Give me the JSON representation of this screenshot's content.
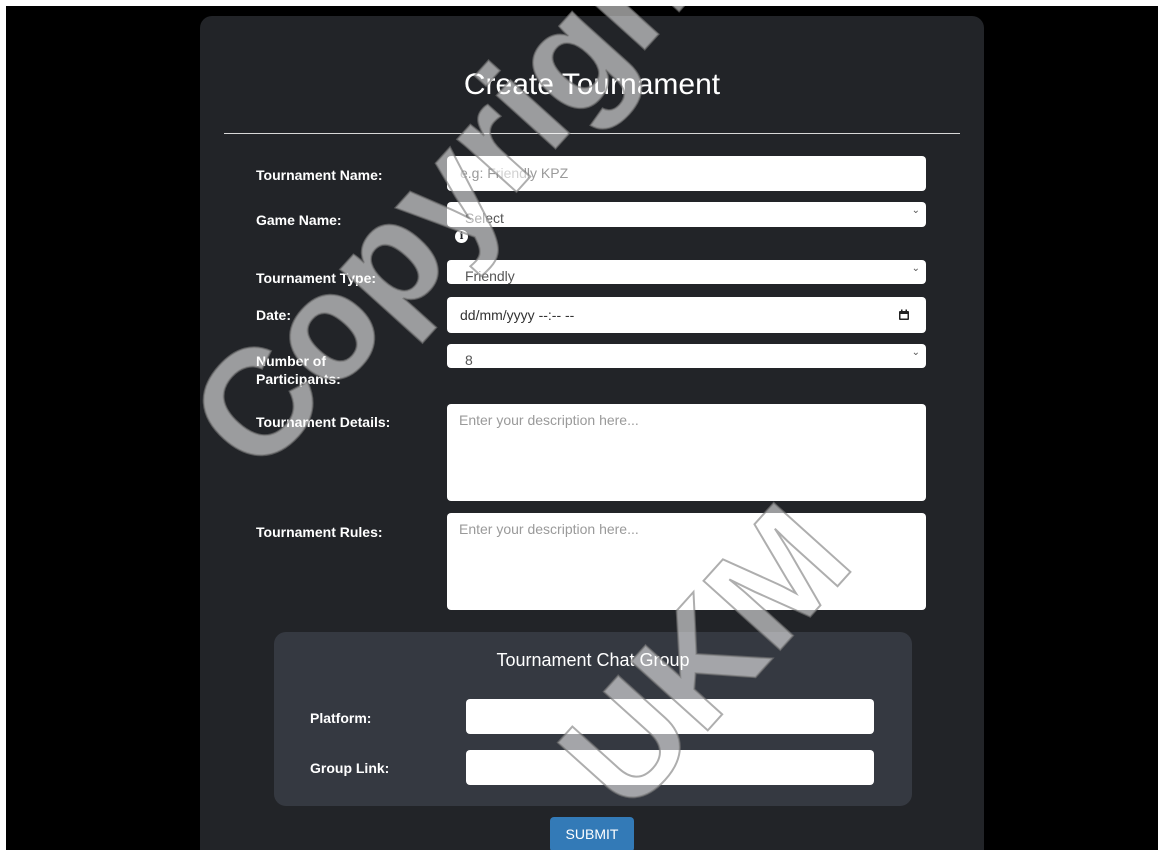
{
  "form": {
    "title": "Create Tournament",
    "fields": {
      "tournament_name": {
        "label": "Tournament Name:",
        "placeholder": "e.g: Friendly KPZ",
        "value": ""
      },
      "game_name": {
        "label": "Game Name:",
        "selected": "Select"
      },
      "tournament_type": {
        "label": "Tournament Type:",
        "selected": "Friendly"
      },
      "date": {
        "label": "Date:",
        "value": "dd/mm/yyyy --:-- --"
      },
      "participants": {
        "label_line1": "Number of",
        "label_line2": "Participants:",
        "selected": "8"
      },
      "details": {
        "label": "Tournament Details:",
        "placeholder": "Enter your description here..."
      },
      "rules": {
        "label": "Tournament Rules:",
        "placeholder": "Enter your description here..."
      }
    },
    "chat_group": {
      "title": "Tournament Chat Group",
      "platform_label": "Platform:",
      "group_link_label": "Group Link:"
    },
    "submit_label": "SUBMIT"
  },
  "icons": {
    "info": "info-icon",
    "dropdown": "chevron-down-icon",
    "calendar": "calendar-icon"
  },
  "watermark": {
    "line1": "Copyright@FTSM",
    "line2": "UKM"
  },
  "colors": {
    "page_background": "#000000",
    "card_background": "#222428",
    "panel_background": "#353941",
    "submit_button": "#337ab7"
  }
}
